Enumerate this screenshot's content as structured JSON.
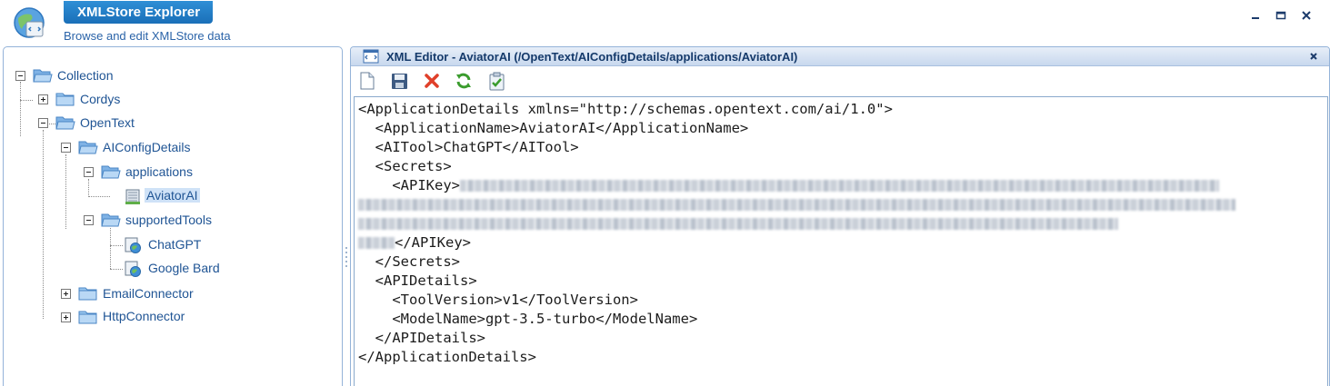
{
  "app": {
    "title": "XMLStore Explorer",
    "subtitle": "Browse and edit XMLStore data",
    "window_controls": [
      "minimize",
      "maximize",
      "close"
    ]
  },
  "tree": {
    "collection": "Collection",
    "cordys": "Cordys",
    "opentext": "OpenText",
    "aiconfigdetails": "AIConfigDetails",
    "applications": "applications",
    "aviatorai": "AviatorAI",
    "supportedtools": "supportedTools",
    "chatgpt": "ChatGPT",
    "googlebard": "Google Bard",
    "emailconnector": "EmailConnector",
    "httpconnector": "HttpConnector",
    "selected": "AviatorAI"
  },
  "editor": {
    "title": "XML Editor - AviatorAI (/OpenText/AIConfigDetails/applications/AviatorAI)",
    "toolbar": [
      "new-document-icon",
      "save-icon",
      "delete-icon",
      "refresh-icon",
      "validate-icon"
    ],
    "lines": {
      "l1": "<ApplicationDetails xmlns=\"http://schemas.opentext.com/ai/1.0\">",
      "l2": "  <ApplicationName>AviatorAI</ApplicationName>",
      "l3": "  <AITool>ChatGPT</AITool>",
      "l4": "  <Secrets>",
      "l5_open": "    <APIKey>",
      "l7_close": "</APIKey>",
      "l8": "  </Secrets>",
      "l9": "  <APIDetails>",
      "l10": "    <ToolVersion>v1</ToolVersion>",
      "l11": "    <ModelName>gpt-3.5-turbo</ModelName>",
      "l12": "  </APIDetails>",
      "l13": "</ApplicationDetails>"
    }
  },
  "colors": {
    "accent": "#1a6fb8",
    "panel_border": "#94b3d9",
    "tree_text": "#1f5494"
  }
}
